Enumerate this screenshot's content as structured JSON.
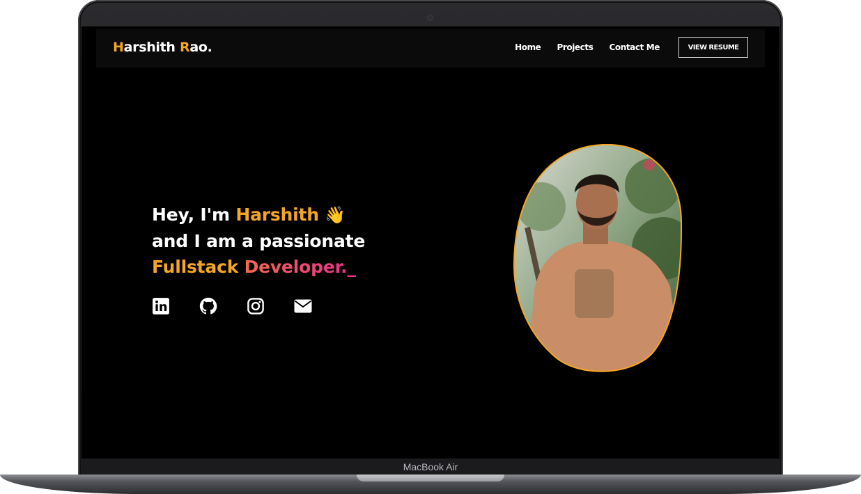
{
  "device": {
    "label": "MacBook Air"
  },
  "site": {
    "brand": {
      "first_initial": "H",
      "first_rest": "arshith ",
      "last_initial": "R",
      "last_rest": "ao."
    },
    "nav": {
      "items": [
        {
          "label": "Home"
        },
        {
          "label": "Projects"
        },
        {
          "label": "Contact Me"
        }
      ],
      "resume_label": "VIEW RESUME"
    },
    "hero": {
      "greeting": "Hey, I'm ",
      "name": "Harshith",
      "wave": "👋",
      "line2": "and I am a passionate",
      "role_part1": "Fullstack ",
      "role_part2": "Developer.",
      "cursor": "_"
    },
    "socials": [
      {
        "icon": "linkedin-icon"
      },
      {
        "icon": "github-icon"
      },
      {
        "icon": "instagram-icon"
      },
      {
        "icon": "envelope-icon"
      }
    ],
    "colors": {
      "accent": "#f5a623",
      "gradient_start": "#f26b4e",
      "gradient_end": "#e8338f",
      "background": "#000000"
    }
  }
}
